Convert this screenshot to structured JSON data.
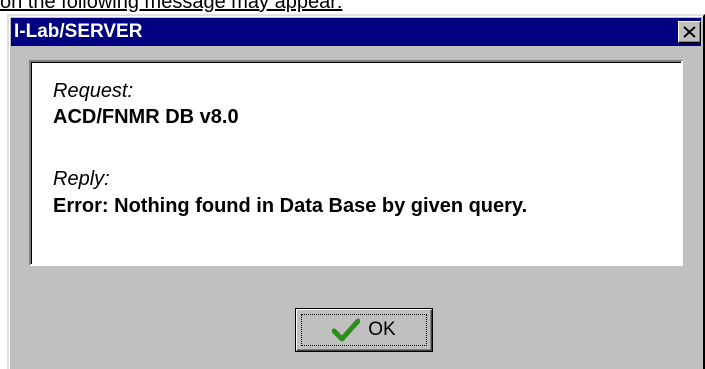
{
  "document": {
    "text_above": "on the following message may appear:"
  },
  "dialog": {
    "title": "I-Lab/SERVER",
    "request_label": "Request:",
    "request_value": "ACD/FNMR DB v8.0",
    "reply_label": "Reply:",
    "reply_value": "Error: Nothing found in Data Base by given query.",
    "ok_label": "OK",
    "icons": {
      "close": "close-icon",
      "ok": "checkmark-icon"
    },
    "colors": {
      "titlebar": "#000080",
      "face": "#c0c0c0",
      "check": "#2e8b1e"
    }
  }
}
